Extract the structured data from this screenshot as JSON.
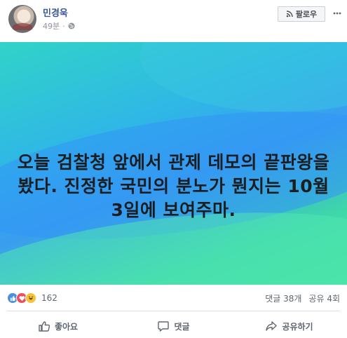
{
  "post": {
    "author": "민경욱",
    "time": "49분",
    "dot": "·",
    "follow_label": "팔로우",
    "text": "오늘 검찰청 앞에서 관제 데모의 끝판왕을 봤다. 진정한 국민의 분노가 뭔지는 10월 3일에 보여주마."
  },
  "reactions": {
    "count": "162",
    "icons": [
      "like-icon",
      "love-icon",
      "haha-icon"
    ]
  },
  "stats": {
    "comments": "댓글 38개",
    "shares": "공유 4회"
  },
  "actions": {
    "like": "좋아요",
    "comment": "댓글",
    "share": "공유하기"
  },
  "colors": {
    "author": "#385898",
    "meta": "#90949c",
    "action_text": "#606770"
  }
}
